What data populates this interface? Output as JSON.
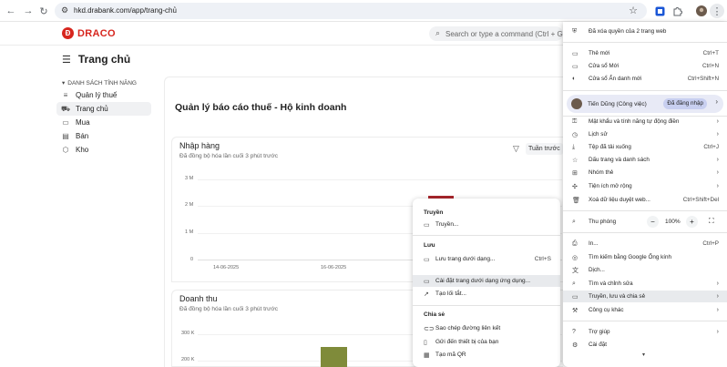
{
  "browser": {
    "url": "hkd.drabank.com/app/trang-chủ"
  },
  "app": {
    "logo_letter": "Đ",
    "logo_text": "DRACO",
    "search_placeholder": "Search or type a command (Ctrl + G)",
    "page_title": "Trang chủ"
  },
  "sidebar": {
    "heading": "DANH SÁCH TÍNH NĂNG",
    "items": [
      {
        "label": "Quản lý thuế",
        "icon": "list-icon"
      },
      {
        "label": "Trang chủ",
        "icon": "car-icon",
        "active": true
      },
      {
        "label": "Mua",
        "icon": "cart-icon"
      },
      {
        "label": "Bán",
        "icon": "store-icon"
      },
      {
        "label": "Kho",
        "icon": "box-icon"
      }
    ]
  },
  "main": {
    "title": "Quản lý báo cáo thuế - Hộ kinh doanh"
  },
  "chart1": {
    "title": "Nhập hàng",
    "subtitle": "Đã đồng bộ hóa lần cuối 3 phút trước",
    "period": "Tuần trước",
    "y_ticks": [
      "3 M",
      "2 M",
      "1 M",
      "0"
    ],
    "x_ticks": [
      "14-06-2025",
      "16-06-2025"
    ]
  },
  "chart2": {
    "title": "Doanh thu",
    "subtitle": "Đã đồng bộ hóa lần cuối 3 phút trước",
    "y_ticks": [
      "300 K",
      "200 K"
    ]
  },
  "chart_data": [
    {
      "type": "bar",
      "title": "Nhập hàng",
      "y_ticks": [
        "3 M",
        "2 M",
        "1 M",
        "0"
      ],
      "ylim": [
        0,
        3000000
      ],
      "x_ticks": [
        "14-06-2025",
        "16-06-2025"
      ],
      "values_visible": [
        {
          "value_approx": 3000000,
          "color": "#a8262c"
        }
      ]
    },
    {
      "type": "bar",
      "title": "Doanh thu",
      "y_ticks": [
        "300 K",
        "200 K"
      ],
      "values_visible": [
        {
          "value_approx": 300000,
          "color": "#7f8b3a"
        }
      ]
    }
  ],
  "submenu": {
    "sections": [
      {
        "heading": "Truyền",
        "items": [
          {
            "label": "Truyền...",
            "icon": "cast-icon"
          }
        ]
      },
      {
        "heading": "Lưu",
        "items": [
          {
            "label": "Lưu trang dưới dạng...",
            "icon": "save-page-icon",
            "shortcut": "Ctrl+S"
          },
          {
            "label": "Cài đặt trang dưới dạng ứng dụng...",
            "icon": "install-app-icon",
            "highlight": true
          },
          {
            "label": "Tạo lối tắt...",
            "icon": "shortcut-icon"
          }
        ]
      },
      {
        "heading": "Chia sẻ",
        "items": [
          {
            "label": "Sao chép đường liên kết",
            "icon": "link-icon"
          },
          {
            "label": "Gửi đến thiết bị của bạn",
            "icon": "send-device-icon"
          },
          {
            "label": "Tạo mã QR",
            "icon": "qr-icon"
          }
        ]
      }
    ]
  },
  "menu": {
    "notice": "Đã xóa quyền của 2 trang web",
    "new_tab": {
      "label": "Thẻ mới",
      "shortcut": "Ctrl+T"
    },
    "new_window": {
      "label": "Cửa sổ Mới",
      "shortcut": "Ctrl+N"
    },
    "incognito": {
      "label": "Cửa sổ Ẩn danh mới",
      "shortcut": "Ctrl+Shift+N"
    },
    "profile": {
      "name": "Tiến Dũng (Công việc)",
      "badge": "Đã đăng nhập"
    },
    "passwords": "Mật khẩu và tính năng tự động điền",
    "history": "Lịch sử",
    "downloads": {
      "label": "Tệp đã tải xuống",
      "shortcut": "Ctrl+J"
    },
    "bookmarks": "Dấu trang và danh sách",
    "tab_groups": "Nhóm thẻ",
    "extensions": "Tiện ích mở rộng",
    "clear_data": {
      "label": "Xoá dữ liệu duyệt web...",
      "shortcut": "Ctrl+Shift+Del"
    },
    "zoom": {
      "label": "Thu phóng",
      "minus": "−",
      "value": "100%",
      "plus": "+"
    },
    "print": {
      "label": "In...",
      "shortcut": "Ctrl+P"
    },
    "lens": "Tìm kiếm bằng Google Ống kính",
    "translate": "Dịch...",
    "find_edit": "Tìm và chỉnh sửa",
    "cast_save_share": "Truyền, lưu và chia sẻ",
    "more_tools": "Công cụ khác",
    "help": "Trợ giúp",
    "settings": "Cài đặt"
  }
}
